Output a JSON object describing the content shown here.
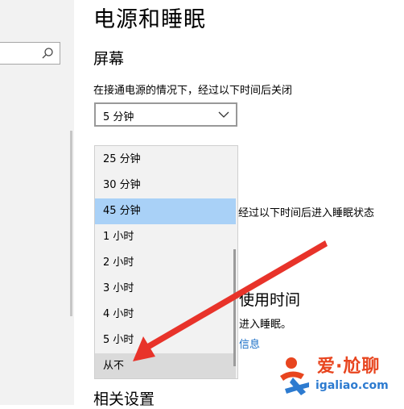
{
  "page": {
    "title": "电源和睡眠"
  },
  "screen": {
    "section_title": "屏幕",
    "on_power_label": "在接通电源的情况下，经过以下时间后关闭",
    "selected_value": "5 分钟"
  },
  "sleep": {
    "label_partial": "经过以下时间后进入睡眠状态"
  },
  "battery": {
    "title_partial": "使用时间",
    "desc_partial": "进入睡眠。",
    "link_partial": "信息"
  },
  "related": {
    "title": "相关设置"
  },
  "dropdown": {
    "options": [
      {
        "label": "25 分钟",
        "state": "normal"
      },
      {
        "label": "30 分钟",
        "state": "normal"
      },
      {
        "label": "45 分钟",
        "state": "selected"
      },
      {
        "label": "1 小时",
        "state": "normal"
      },
      {
        "label": "2 小时",
        "state": "normal"
      },
      {
        "label": "3 小时",
        "state": "normal"
      },
      {
        "label": "4 小时",
        "state": "normal"
      },
      {
        "label": "5 小时",
        "state": "normal"
      },
      {
        "label": "从不",
        "state": "hover"
      }
    ]
  },
  "annotation": {
    "arrow_color": "#e8332a"
  },
  "watermark": {
    "brand": "爱·尬聊",
    "url": "igaliao.com"
  },
  "colors": {
    "selected": "#a9d1f7",
    "hover": "#dadada",
    "link": "#1a6fc7"
  },
  "icons": [
    "search-icon",
    "chevron-down-icon",
    "red-arrow",
    "watermark-logo"
  ]
}
